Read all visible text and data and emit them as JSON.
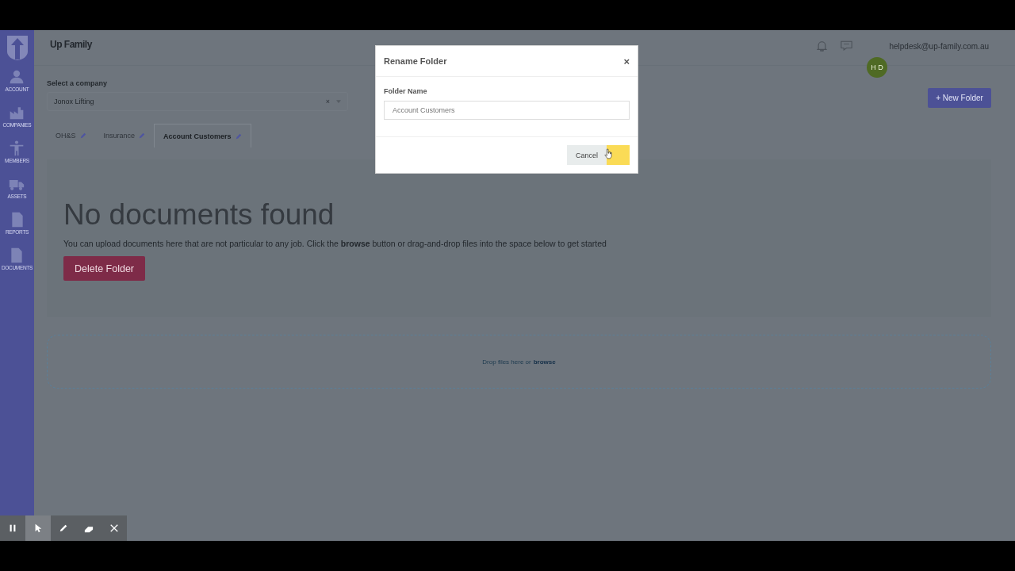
{
  "sidebar": {
    "items": [
      {
        "kind": "account",
        "label": "ACCOUNT"
      },
      {
        "kind": "companies",
        "label": "COMPANIES"
      },
      {
        "kind": "members",
        "label": "MEMBERS"
      },
      {
        "kind": "assets",
        "label": "ASSETS"
      },
      {
        "kind": "reports",
        "label": "REPORTS"
      },
      {
        "kind": "documents",
        "label": "DOCUMENTS"
      }
    ]
  },
  "header": {
    "logo": "Up Family",
    "email": "helpdesk@up-family.com.au",
    "avatar": "H D"
  },
  "company": {
    "label": "Select a company",
    "value": "Jonox Lifting",
    "clear": "×"
  },
  "new_folder": "+ New Folder",
  "tabs": [
    {
      "label": "OH&S",
      "selected": false
    },
    {
      "label": "Insurance",
      "selected": false
    },
    {
      "label": "Account Customers",
      "selected": true
    }
  ],
  "empty": {
    "title": "No documents found",
    "text": "You can upload documents here that are not particular to any job. Click the **browse** button or drag-and-drop files into the space below to get started",
    "delete": "Delete Folder"
  },
  "dropzone": {
    "text": "Drop files here or",
    "link": "browse"
  },
  "modal": {
    "title": "Rename Folder",
    "close": "×",
    "field_label": "Folder Name",
    "value": "Account Customers",
    "cancel": "Cancel"
  },
  "toolbar": [
    {
      "kind": "pause",
      "selected": false
    },
    {
      "kind": "pointer",
      "selected": true
    },
    {
      "kind": "pen",
      "selected": false
    },
    {
      "kind": "eraser",
      "selected": false
    },
    {
      "kind": "close",
      "selected": false
    }
  ]
}
